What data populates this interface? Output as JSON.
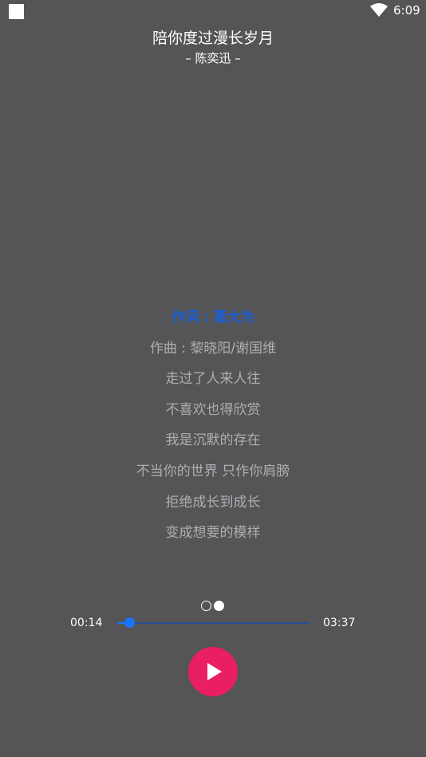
{
  "status_bar": {
    "time": "6:09",
    "icons": [
      "notification-square-icon",
      "wifi-icon"
    ]
  },
  "song": {
    "title": "陪你度过漫长岁月",
    "artist_line": "– 陈奕迅 –"
  },
  "lyrics": {
    "active_index": 0,
    "lines": [
      "作词 : 葛大为",
      "作曲 : 黎晓阳/谢国维",
      "走过了人来人往",
      "不喜欢也得欣赏",
      "我是沉默的存在",
      "不当你的世界 只作你肩膀",
      "拒绝成长到成长",
      "变成想要的模样"
    ]
  },
  "pager": {
    "count": 2,
    "active": 1
  },
  "player": {
    "current_time": "00:14",
    "total_time": "03:37",
    "progress_fraction": 0.064,
    "play_icon": "play-icon",
    "accent_color": "#e91e63",
    "progress_color": "#1a73ff"
  }
}
